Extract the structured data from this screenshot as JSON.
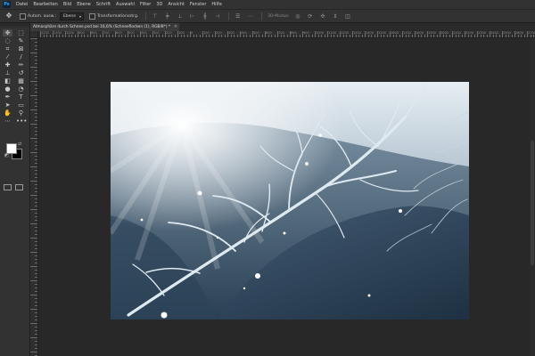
{
  "app": {
    "logo_text": "Ps"
  },
  "menu": [
    "Datei",
    "Bearbeiten",
    "Bild",
    "Ebene",
    "Schrift",
    "Auswahl",
    "Filter",
    "3D",
    "Ansicht",
    "Fenster",
    "Hilfe"
  ],
  "options": {
    "tool_icon": "move-icon",
    "auto_select_label": "Autom. ausw.:",
    "auto_select_value": "Ebene",
    "transform_label": "Transformationsstrg.",
    "align_icons": [
      "align-top-icon",
      "align-vcenter-icon",
      "align-bottom-icon",
      "align-left-icon",
      "align-hcenter-icon",
      "align-right-icon"
    ],
    "distribute_icons": [
      "distribute-icon"
    ],
    "threed_label": "3D-Modus:",
    "threed_icons": [
      "orbit-icon",
      "roll-icon",
      "pan-icon",
      "slide-icon",
      "scale-icon"
    ]
  },
  "document": {
    "tab_title": "Atmosphäre durch Schnee.psd bei 16,6% (Schneeflocken (1), RGB/8*) *",
    "close_symbol": "×"
  },
  "ruler_numbers": [
    "1200",
    "1100",
    "1000",
    "900",
    "800",
    "700",
    "600",
    "500",
    "400",
    "300",
    "200",
    "100",
    "0",
    "100",
    "200",
    "300",
    "400",
    "500",
    "600",
    "700",
    "800",
    "900",
    "1000",
    "1100",
    "1200",
    "1300",
    "1400",
    "1500",
    "1600",
    "1700",
    "1800",
    "1900",
    "2000",
    "2100",
    "2200",
    "2300",
    "2400",
    "2500",
    "2600",
    "2700"
  ],
  "tools": [
    {
      "name": "move-tool",
      "glyph": "✥",
      "active": true
    },
    {
      "name": "marquee-tool",
      "glyph": "⬚"
    },
    {
      "name": "lasso-tool",
      "glyph": "◌"
    },
    {
      "name": "quick-select-tool",
      "glyph": "✎"
    },
    {
      "name": "crop-tool",
      "glyph": "⌗"
    },
    {
      "name": "frame-tool",
      "glyph": "⊠"
    },
    {
      "name": "eyedropper-tool",
      "glyph": "⁄"
    },
    {
      "name": "ruler-tool",
      "glyph": "∕"
    },
    {
      "name": "healing-brush-tool",
      "glyph": "✚"
    },
    {
      "name": "brush-tool",
      "glyph": "✏"
    },
    {
      "name": "clone-stamp-tool",
      "glyph": "⊥"
    },
    {
      "name": "history-brush-tool",
      "glyph": "↺"
    },
    {
      "name": "eraser-tool",
      "glyph": "◧"
    },
    {
      "name": "gradient-tool",
      "glyph": "▦"
    },
    {
      "name": "blur-tool",
      "glyph": "●"
    },
    {
      "name": "dodge-tool",
      "glyph": "◔"
    },
    {
      "name": "pen-tool",
      "glyph": "✒"
    },
    {
      "name": "type-tool",
      "glyph": "T"
    },
    {
      "name": "path-select-tool",
      "glyph": "➤"
    },
    {
      "name": "rectangle-tool",
      "glyph": "▭"
    },
    {
      "name": "hand-tool",
      "glyph": "✋"
    },
    {
      "name": "zoom-tool",
      "glyph": "⚲"
    },
    {
      "name": "edit-toolbar",
      "glyph": "⋯"
    },
    {
      "name": "extra-tool",
      "glyph": "•••"
    }
  ],
  "colors": {
    "foreground": "#ffffff",
    "background": "#000000"
  },
  "theme": {
    "panel": "#323232",
    "canvas_bg": "#282828",
    "accent": "#31a8ff"
  }
}
